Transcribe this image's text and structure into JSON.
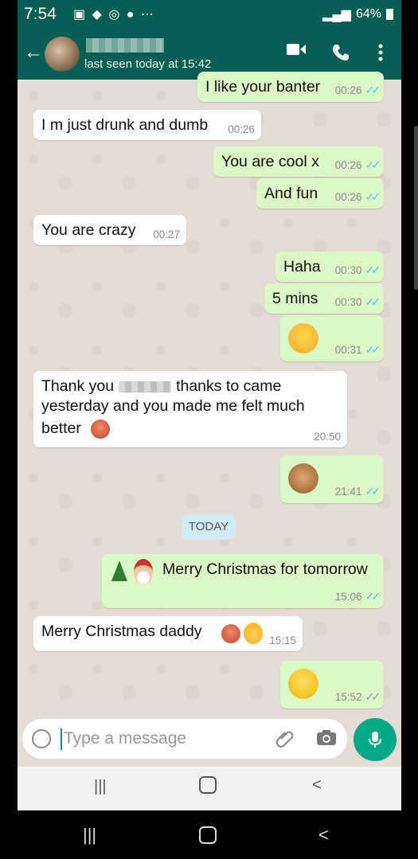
{
  "status_bar": {
    "time": "7:54",
    "battery": "64%"
  },
  "header": {
    "last_seen": "last seen today at 15:42"
  },
  "messages": [
    {
      "dir": "out",
      "text": "I like your banter",
      "time": "00:26"
    },
    {
      "dir": "in",
      "text": "I m just drunk and dumb",
      "time": "00:26"
    },
    {
      "dir": "out",
      "text": "You are cool x",
      "time": "00:26"
    },
    {
      "dir": "out",
      "text": "And fun",
      "time": "00:26"
    },
    {
      "dir": "in",
      "text": "You are crazy",
      "time": "00:27"
    },
    {
      "dir": "out",
      "text": "Haha",
      "time": "00:30"
    },
    {
      "dir": "out",
      "text": "5 mins",
      "time": "00:30"
    },
    {
      "dir": "out",
      "emoji": "kissing-heart",
      "time": "00:31"
    },
    {
      "dir": "in",
      "line1_a": "Thank you",
      "line1_b": "thanks to  came",
      "line2": "yesterday and you made me felt much",
      "line3": "better",
      "time": "20:50"
    },
    {
      "dir": "out",
      "emoji": "see-no-evil-monkey",
      "time": "21:41"
    },
    {
      "dir": "out",
      "text": "Merry Christmas for tomorrow",
      "time": "15:06"
    },
    {
      "dir": "in",
      "text": "Merry Christmas daddy",
      "time": "15:15"
    },
    {
      "dir": "out",
      "emoji": "winking-face",
      "time": "15:52"
    }
  ],
  "date_divider": "TODAY",
  "input": {
    "placeholder": "Type a message"
  },
  "colors": {
    "header": "#075e54",
    "outgoing": "#dcf8c6",
    "incoming": "#ffffff",
    "accent": "#00a884",
    "read_tick": "#4fc3f7"
  }
}
